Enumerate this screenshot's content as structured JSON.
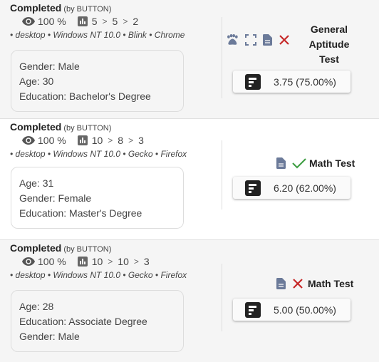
{
  "rows": [
    {
      "status": "Completed",
      "status_by": "(by BUTTON)",
      "view_percent": "100 %",
      "counts": [
        "5",
        "5",
        "2"
      ],
      "environment": "• desktop • Windows NT 10.0 • Blink • Chrome",
      "details": [
        "Gender: Male",
        "Age: 30",
        "Education: Bachelor's Degree"
      ],
      "icons": [
        "paw-icon",
        "fullscreen-icon",
        "document-icon",
        "fail-x-icon"
      ],
      "test_title": "General Aptitude Test",
      "test_title_lines": [
        "General",
        "Aptitude",
        "Test"
      ],
      "result": "fail",
      "score": "3.75 (75.00%)"
    },
    {
      "status": "Completed",
      "status_by": "(by BUTTON)",
      "view_percent": "100 %",
      "counts": [
        "10",
        "8",
        "3"
      ],
      "environment": "• desktop • Windows NT 10.0 • Gecko • Firefox",
      "details": [
        "Age: 31",
        "Gender: Female",
        "Education: Master's Degree"
      ],
      "icons": [
        "document-icon",
        "pass-check-icon"
      ],
      "test_title": "Math Test",
      "result": "pass",
      "score": "6.20 (62.00%)"
    },
    {
      "status": "Completed",
      "status_by": "(by BUTTON)",
      "view_percent": "100 %",
      "counts": [
        "10",
        "10",
        "3"
      ],
      "environment": "• desktop • Windows NT 10.0 • Gecko • Firefox",
      "details": [
        "Age: 28",
        "Education: Associate Degree",
        "Gender: Male"
      ],
      "icons": [
        "document-icon",
        "fail-x-icon"
      ],
      "test_title": "Math Test",
      "result": "fail",
      "score": "5.00 (50.00%)"
    }
  ],
  "colors": {
    "icon_slate": "#6b7a99",
    "fail_red": "#c62828",
    "pass_green": "#43a047",
    "score_icon": "#222222"
  },
  "separator": ">"
}
